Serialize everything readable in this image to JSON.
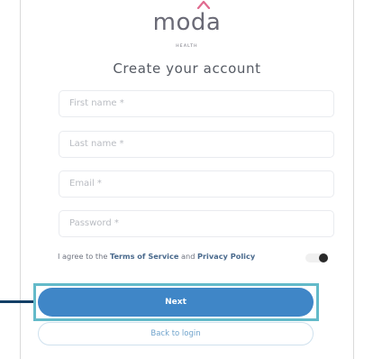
{
  "brand": {
    "name": "moda",
    "sub": "HEALTH"
  },
  "title": "Create your account",
  "fields": [
    {
      "placeholder": "First name *"
    },
    {
      "placeholder": "Last name *"
    },
    {
      "placeholder": "Email *"
    },
    {
      "placeholder": "Password *"
    }
  ],
  "terms": {
    "prefix": "I agree to the ",
    "tos": "Terms of Service",
    "and": " and ",
    "privacy": "Privacy Policy",
    "toggle_on": false
  },
  "buttons": {
    "next": "Next",
    "back": "Back to login"
  },
  "colors": {
    "primary": "#3f86c7",
    "highlight": "#63bac9",
    "callout": "#123f66",
    "logo_roof": "#e06b8f"
  }
}
